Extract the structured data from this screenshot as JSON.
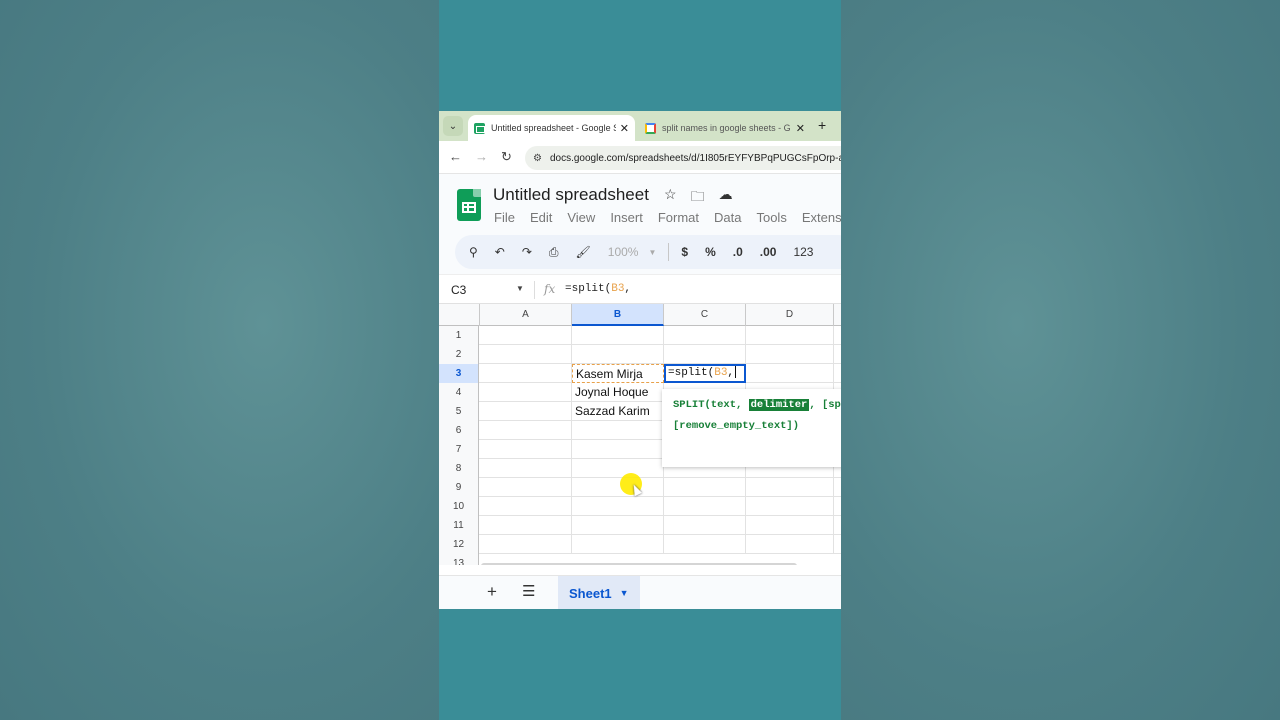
{
  "browser": {
    "tabs": [
      {
        "title": "Untitled spreadsheet - Google S",
        "icon": "sheets-favicon"
      },
      {
        "title": "split names in google sheets - G",
        "icon": "google-favicon"
      }
    ],
    "url": "docs.google.com/spreadsheets/d/1I805rEYFYBPqPUGCsFpOrp-a"
  },
  "doc": {
    "title": "Untitled spreadsheet",
    "menu": [
      "File",
      "Edit",
      "View",
      "Insert",
      "Format",
      "Data",
      "Tools",
      "Extensi"
    ]
  },
  "toolbar": {
    "zoom": "100%",
    "currency": "$",
    "percent": "%",
    "decrease_decimal": ".0",
    "increase_decimal": ".00",
    "number_format": "123"
  },
  "formula_bar": {
    "cell_ref": "C3",
    "fx": "fx",
    "formula_prefix": "=split(",
    "formula_ref": "B3",
    "formula_suffix": ", "
  },
  "grid": {
    "columns": [
      "A",
      "B",
      "C",
      "D"
    ],
    "rows": [
      "1",
      "2",
      "3",
      "4",
      "5",
      "6",
      "7",
      "8",
      "9",
      "10",
      "11",
      "12",
      "13"
    ],
    "cells": {
      "B3": "Kasem Mirja",
      "B4": "Joynal Hoque",
      "B5": "Sazzad Karim"
    },
    "active_cell": {
      "prefix": "=split(",
      "ref": "B3",
      "suffix": ","
    }
  },
  "autocomplete": {
    "fn": "SPLIT(text, ",
    "highlight": "delimiter",
    "rest": ", [sp",
    "line2": "[remove_empty_text])"
  },
  "sheets": {
    "tabs": [
      "Sheet1"
    ]
  },
  "colors": {
    "accent": "#0b57d0",
    "reference": "#e8a14a",
    "hint_green": "#188038",
    "tab_strip": "#d3e3c8"
  }
}
